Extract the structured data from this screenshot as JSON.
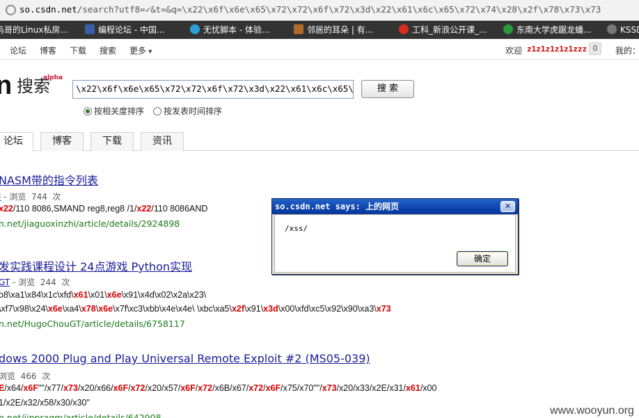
{
  "browser": {
    "url_host": "so.csdn.net",
    "url_rest": "/search?utf8=✓&t=&q=\\x22\\x6f\\x6e\\x65\\x72\\x72\\x6f\\x72\\x3d\\x22\\x61\\x6c\\x65\\x72\\x74\\x28\\x2f\\x78\\x73\\x73",
    "bookmarks": [
      {
        "label": "鸟哥的Linux私房...",
        "icon": "page-icon",
        "color": "#cc8800"
      },
      {
        "label": "编程论坛 - 中国...",
        "icon": "forum-icon",
        "color": "#3a5fa8"
      },
      {
        "label": "无忧脚本 - 体验...",
        "icon": "script-icon",
        "color": "#2f9fd8"
      },
      {
        "label": "邻居的耳朵 | 有...",
        "icon": "ear-icon",
        "color": "#b06a2a"
      },
      {
        "label": "工科_新浪公开课_...",
        "icon": "weibo-icon",
        "color": "#d62d20"
      },
      {
        "label": "东南大学虎踞龙蟠...",
        "icon": "seu-icon",
        "color": "#2a9a3a"
      },
      {
        "label": "KSSD",
        "icon": "github-icon",
        "color": "#777777"
      }
    ]
  },
  "topnav": {
    "items": [
      "论坛",
      "博客",
      "下载",
      "搜索",
      "更多"
    ],
    "welcome": "欢迎",
    "username": "z1z1z1z1z1zzz",
    "msg_count": "0",
    "mine": "我的："
  },
  "logo": {
    "text": "搜索",
    "badge": "alpha"
  },
  "search": {
    "query": "\\x22\\x6f\\x6e\\x65\\x72\\x72\\x6f\\x72\\x3d\\x22\\x61\\x6c\\x65\\x72",
    "button": "搜 索",
    "sort_relevance": "按相关度排序",
    "sort_time": "按发表时间排序"
  },
  "tabs": [
    "论坛",
    "博客",
    "下载",
    "资讯"
  ],
  "results": [
    {
      "title": "NASM带的指令列表",
      "author": "i",
      "views_label": "浏览",
      "views": "744",
      "views_unit": "次",
      "snippet": [
        {
          "text": "x22",
          "hl": true
        },
        {
          "text": "/110    8086,SMAND  reg8,reg8   /1/",
          "hl": false
        },
        {
          "text": "x22",
          "hl": true
        },
        {
          "text": "/110    8086AND",
          "hl": false
        }
      ],
      "url": "n.net/jiaguoxinzhi/article/details/2924898"
    },
    {
      "title": "发实践课程设计 24点游戏 Python实现",
      "author": "GT",
      "views_label": "浏览",
      "views": "244",
      "views_unit": "次",
      "snippet1": [
        {
          "text": "b8\\xa1\\x84\\x1c\\xfd\\",
          "hl": false
        },
        {
          "text": "x61",
          "hl": true
        },
        {
          "text": "\\x01\\",
          "hl": false
        },
        {
          "text": "x6e",
          "hl": true
        },
        {
          "text": "\\x91\\x4d\\x02\\x2a\\x23\\",
          "hl": false
        }
      ],
      "snippet2": [
        {
          "text": "\\xf7\\x98\\x24\\",
          "hl": false
        },
        {
          "text": "x6e",
          "hl": true
        },
        {
          "text": "\\xa4\\",
          "hl": false
        },
        {
          "text": "x78",
          "hl": true
        },
        {
          "text": "\\",
          "hl": false
        },
        {
          "text": "x6e",
          "hl": true
        },
        {
          "text": "\\x7f\\xc3\\xbb\\x4e\\x4e\\ \\xbc\\xa5\\",
          "hl": false
        },
        {
          "text": "x2f",
          "hl": true
        },
        {
          "text": "\\x91\\",
          "hl": false
        },
        {
          "text": "x3d",
          "hl": true
        },
        {
          "text": "\\x00\\xfd\\xc5\\x92\\x90\\xa3\\",
          "hl": false
        },
        {
          "text": "x73",
          "hl": true
        }
      ],
      "url": "n.net/HugoChouGT/article/details/6758117"
    },
    {
      "title": "dows 2000 Plug and Play Universal Remote Exploit #2 (MS05-039)",
      "views_label": "浏览",
      "views": "466",
      "views_unit": "次",
      "snippet1": [
        {
          "text": "E",
          "hl": true
        },
        {
          "text": "/x64/",
          "hl": false
        },
        {
          "text": "x6F",
          "hl": true
        },
        {
          "text": "\"\"/x77/",
          "hl": false
        },
        {
          "text": "x73",
          "hl": true
        },
        {
          "text": "/x20/x66/",
          "hl": false
        },
        {
          "text": "x6F",
          "hl": true
        },
        {
          "text": "/",
          "hl": false
        },
        {
          "text": "x72",
          "hl": true
        },
        {
          "text": "/x20/x57/",
          "hl": false
        },
        {
          "text": "x6F",
          "hl": true
        },
        {
          "text": "/",
          "hl": false
        },
        {
          "text": "x72",
          "hl": true
        },
        {
          "text": "/x6B/x67/",
          "hl": false
        },
        {
          "text": "x72",
          "hl": true
        },
        {
          "text": "/",
          "hl": false
        },
        {
          "text": "x6F",
          "hl": true
        },
        {
          "text": "/x75/x70\"\"/",
          "hl": false
        },
        {
          "text": "x73",
          "hl": true
        },
        {
          "text": "/x20/x33/x2E/x31/",
          "hl": false
        },
        {
          "text": "x61",
          "hl": true
        },
        {
          "text": "/x00",
          "hl": false
        }
      ],
      "snippet2": "1/x2E/x32/x58/x30/x30\"",
      "url": "n.net/jinpragm/article/details/642908"
    }
  ],
  "dialog": {
    "title": "so.csdn.net says: 上的网页",
    "close": "✕",
    "message": "/xss/",
    "ok": "确定"
  },
  "watermark": "www.wooyun.org"
}
